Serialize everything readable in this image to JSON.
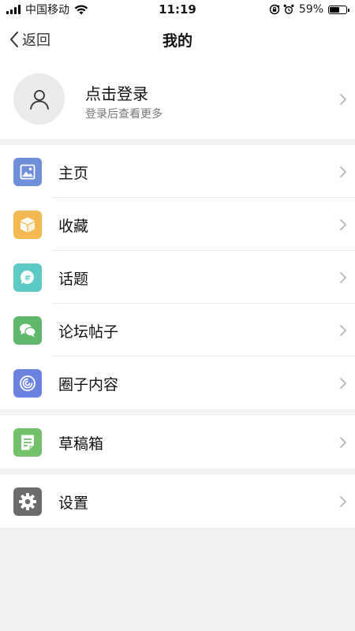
{
  "status_bar": {
    "carrier": "中国移动",
    "time": "11:19",
    "battery_percent_label": "59%",
    "battery_level": 0.59
  },
  "nav": {
    "back_label": "返回",
    "title": "我的"
  },
  "profile": {
    "name": "点击登录",
    "subtitle": "登录后查看更多"
  },
  "menu_group_1": [
    {
      "label": "主页",
      "icon": "image-icon",
      "color": "#6f8fdb"
    },
    {
      "label": "收藏",
      "icon": "box-icon",
      "color": "#f5b951"
    },
    {
      "label": "话题",
      "icon": "hashtag-chat-icon",
      "color": "#5ccbc5"
    },
    {
      "label": "论坛帖子",
      "icon": "chat-bubbles-icon",
      "color": "#5fb86b"
    },
    {
      "label": "圈子内容",
      "icon": "circle-swirl-icon",
      "color": "#6b82e0"
    }
  ],
  "menu_group_2": [
    {
      "label": "草稿箱",
      "icon": "draft-document-icon",
      "color": "#72c06a"
    }
  ],
  "menu_group_3": [
    {
      "label": "设置",
      "icon": "gear-icon",
      "color": "#6b6b6b"
    }
  ]
}
